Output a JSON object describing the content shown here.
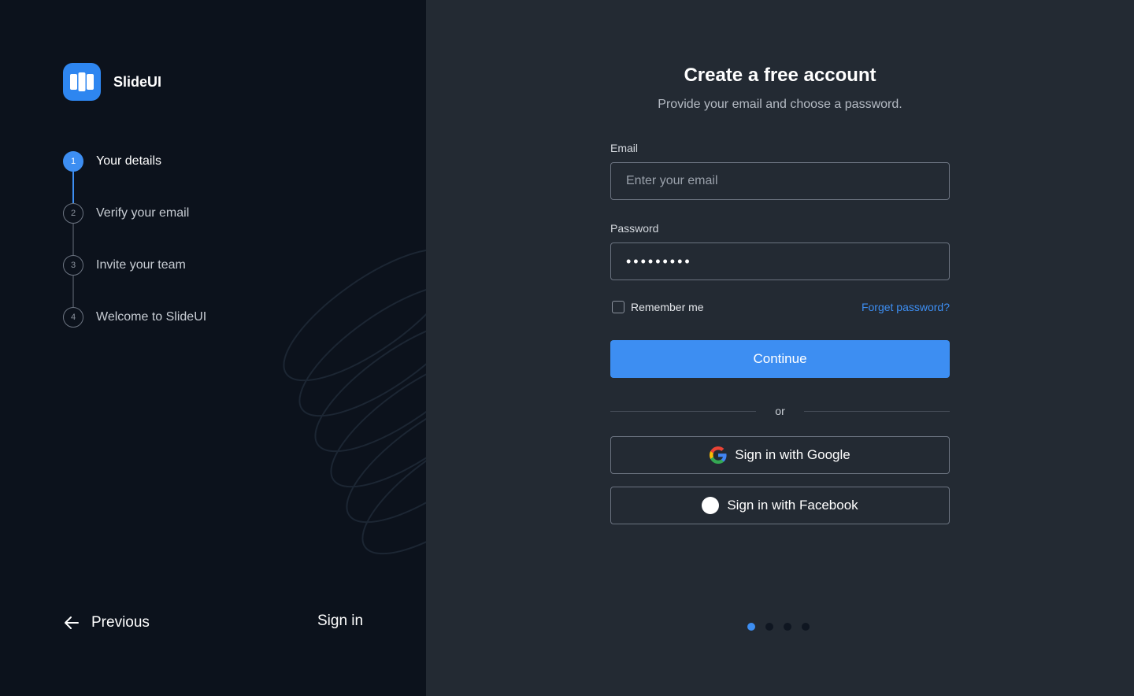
{
  "brand": {
    "name": "SlideUI",
    "logo_color": "#2e86f0"
  },
  "steps": [
    {
      "number": "1",
      "label": "Your details",
      "active": true
    },
    {
      "number": "2",
      "label": "Verify your email",
      "active": false
    },
    {
      "number": "3",
      "label": "Invite your team",
      "active": false
    },
    {
      "number": "4",
      "label": "Welcome to SlideUI",
      "active": false
    }
  ],
  "nav": {
    "previous_label": "Previous",
    "signin_label": "Sign in"
  },
  "form": {
    "title": "Create a free account",
    "subtitle": "Provide your email and choose a password.",
    "email_label": "Email",
    "email_placeholder": "Enter your email",
    "email_value": "",
    "password_label": "Password",
    "password_value": "•••••••••",
    "remember_label": "Remember me",
    "remember_checked": false,
    "forgot_label": "Forget password?",
    "continue_label": "Continue",
    "divider_text": "or",
    "google_label": "Sign in with Google",
    "facebook_label": "Sign in with Facebook"
  },
  "pagination": {
    "total": 4,
    "current": 1
  },
  "colors": {
    "accent": "#3d8ef2",
    "left_bg": "#0c121c",
    "right_bg": "#232a33"
  },
  "icons": {
    "logo": "book-open-icon",
    "previous": "arrow-left-icon",
    "google": "google-g-icon",
    "facebook": "facebook-circle-icon"
  }
}
